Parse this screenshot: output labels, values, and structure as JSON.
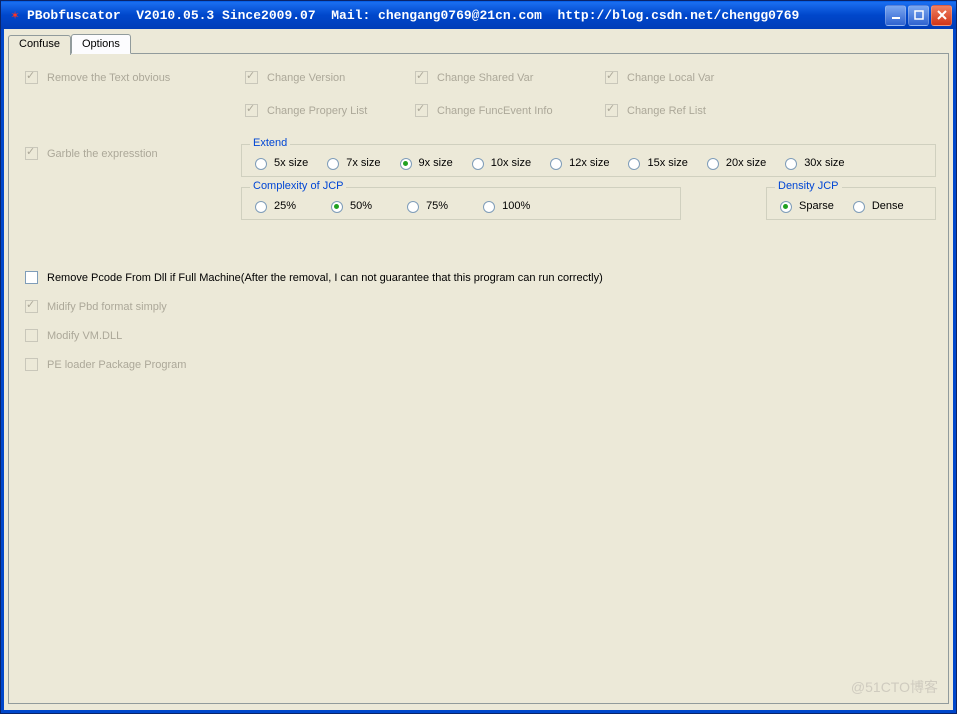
{
  "title": "PBobfuscator  V2010.05.3 Since2009.07  Mail: chengang0769@21cn.com  http://blog.csdn.net/chengg0769",
  "tabs": {
    "confuse": "Confuse",
    "options": "Options"
  },
  "checks": {
    "remove_text": "Remove the Text obvious",
    "change_version": "Change Version",
    "change_shared_var": "Change Shared Var",
    "change_local_var": "Change Local Var",
    "change_propery_list": "Change Propery List",
    "change_funcevent": "Change FuncEvent Info",
    "change_ref_list": "Change Ref List",
    "garble_expr": "Garble the expresstion",
    "remove_pcode": "Remove Pcode From Dll if Full Machine(After the removal, I can not guarantee that this program can run correctly)",
    "midify_pbd": "Midify Pbd format simply",
    "modify_vmdll": "Modify VM.DLL",
    "pe_loader": "PE loader Package Program"
  },
  "groups": {
    "extend": {
      "title": "Extend",
      "opts": [
        "5x size",
        "7x size",
        "9x size",
        "10x size",
        "12x size",
        "15x size",
        "20x size",
        "30x size"
      ],
      "selected": "9x size"
    },
    "complexity": {
      "title": "Complexity of JCP",
      "opts": [
        "25%",
        "50%",
        "75%",
        "100%"
      ],
      "selected": "50%"
    },
    "density": {
      "title": "Density JCP",
      "opts": [
        "Sparse",
        "Dense"
      ],
      "selected": "Sparse"
    }
  },
  "watermark": "@51CTO博客"
}
